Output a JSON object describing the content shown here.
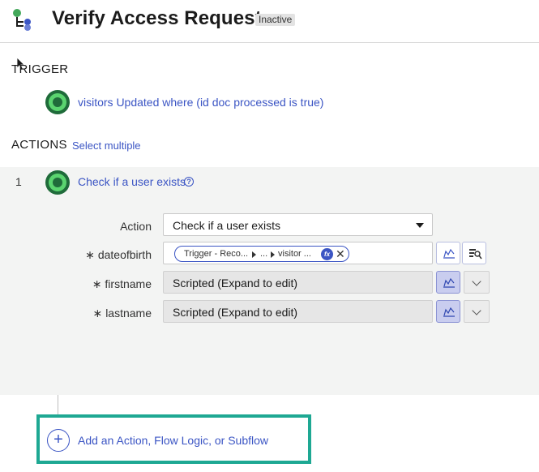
{
  "header": {
    "title": "Verify Access Request",
    "status_badge": "Inactive"
  },
  "trigger": {
    "section_label": "TRIGGER",
    "description": "visitors Updated where (id doc processed is true)"
  },
  "actions": {
    "section_label": "ACTIONS",
    "select_multiple_label": "Select multiple",
    "items": [
      {
        "number": "1",
        "title": "Check if a user exists",
        "fields": {
          "action_label": "Action",
          "action_value": "Check if a user exists",
          "dateofbirth_label": "dateofbirth",
          "dateofbirth_pill": {
            "part1": "Trigger - Reco...",
            "part2": "...",
            "part3": "visitor ...",
            "fx_label": "fx"
          },
          "firstname_label": "firstname",
          "firstname_value": "Scripted (Expand to edit)",
          "lastname_label": "lastname",
          "lastname_value": "Scripted (Expand to edit)",
          "required_marker": "∗"
        }
      }
    ]
  },
  "add_step": {
    "label": "Add an Action, Flow Logic, or Subflow",
    "plus": "+"
  },
  "colors": {
    "link": "#3b55c4",
    "highlight": "#1ea893",
    "avatar_ring": "#5ad46f"
  }
}
